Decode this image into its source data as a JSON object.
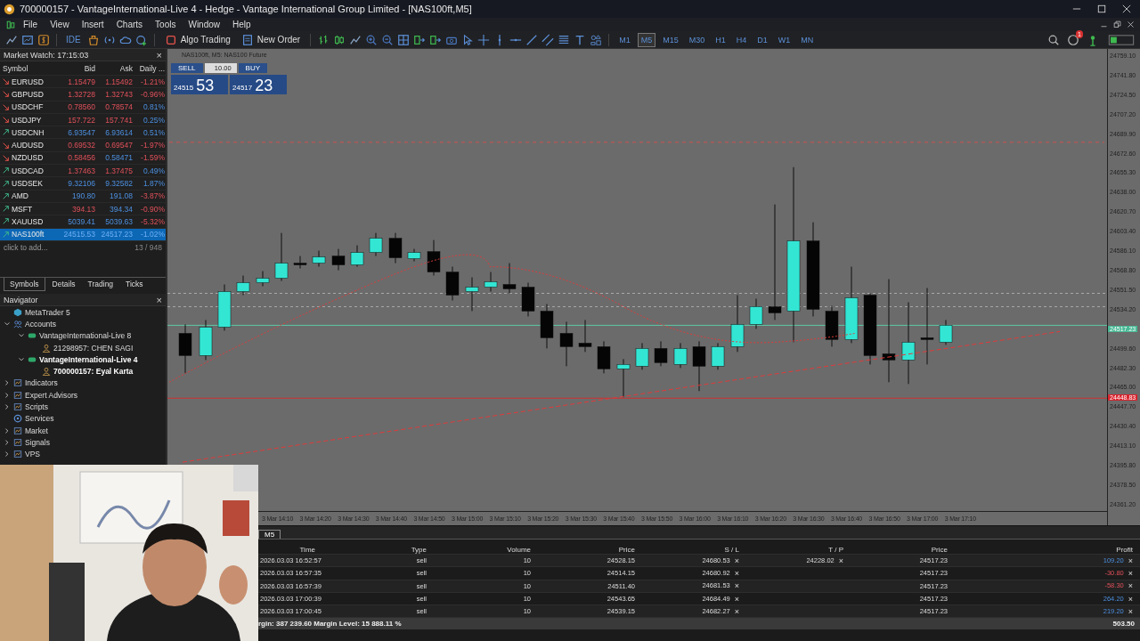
{
  "window": {
    "title": "700000157 - VantageInternational-Live 4 - Hedge - Vantage International Group Limited - [NAS100ft,M5]"
  },
  "menu": [
    "File",
    "View",
    "Insert",
    "Charts",
    "Tools",
    "Window",
    "Help"
  ],
  "toolbar": {
    "ide": "IDE",
    "algo_trading": "Algo Trading",
    "new_order": "New Order",
    "timeframes": [
      {
        "label": "M1",
        "selected": false
      },
      {
        "label": "M5",
        "selected": true
      },
      {
        "label": "M15",
        "selected": false
      },
      {
        "label": "M30",
        "selected": false
      },
      {
        "label": "H1",
        "selected": false
      },
      {
        "label": "H4",
        "selected": false
      },
      {
        "label": "D1",
        "selected": false
      },
      {
        "label": "W1",
        "selected": false
      },
      {
        "label": "MN",
        "selected": false
      }
    ],
    "notifications": "1"
  },
  "market_watch": {
    "title": "Market Watch: 17:15:03",
    "columns": [
      "Symbol",
      "Bid",
      "Ask",
      "Daily ..."
    ],
    "rows": [
      {
        "symbol": "EURUSD",
        "rising": false,
        "bid": "1.15479",
        "bid_up": false,
        "ask": "1.15492",
        "ask_up": false,
        "daily": "-1.21%",
        "daily_up": false,
        "selected": false
      },
      {
        "symbol": "GBPUSD",
        "rising": false,
        "bid": "1.32728",
        "bid_up": false,
        "ask": "1.32743",
        "ask_up": false,
        "daily": "-0.96%",
        "daily_up": false,
        "selected": false
      },
      {
        "symbol": "USDCHF",
        "rising": false,
        "bid": "0.78560",
        "bid_up": false,
        "ask": "0.78574",
        "ask_up": false,
        "daily": "0.81%",
        "daily_up": true,
        "selected": false
      },
      {
        "symbol": "USDJPY",
        "rising": false,
        "bid": "157.722",
        "bid_up": false,
        "ask": "157.741",
        "ask_up": false,
        "daily": "0.25%",
        "daily_up": true,
        "selected": false
      },
      {
        "symbol": "USDCNH",
        "rising": true,
        "bid": "6.93547",
        "bid_up": true,
        "ask": "6.93614",
        "ask_up": true,
        "daily": "0.51%",
        "daily_up": true,
        "selected": false
      },
      {
        "symbol": "AUDUSD",
        "rising": false,
        "bid": "0.69532",
        "bid_up": false,
        "ask": "0.69547",
        "ask_up": false,
        "daily": "-1.97%",
        "daily_up": false,
        "selected": false
      },
      {
        "symbol": "NZDUSD",
        "rising": false,
        "bid": "0.58456",
        "bid_up": false,
        "ask": "0.58471",
        "ask_up": true,
        "daily": "-1.59%",
        "daily_up": false,
        "selected": false
      },
      {
        "symbol": "USDCAD",
        "rising": true,
        "bid": "1.37463",
        "bid_up": false,
        "ask": "1.37475",
        "ask_up": false,
        "daily": "0.49%",
        "daily_up": true,
        "selected": false
      },
      {
        "symbol": "USDSEK",
        "rising": true,
        "bid": "9.32106",
        "bid_up": true,
        "ask": "9.32582",
        "ask_up": true,
        "daily": "1.87%",
        "daily_up": true,
        "selected": false
      },
      {
        "symbol": "AMD",
        "rising": true,
        "bid": "190.80",
        "bid_up": true,
        "ask": "191.08",
        "ask_up": true,
        "daily": "-3.87%",
        "daily_up": false,
        "selected": false
      },
      {
        "symbol": "MSFT",
        "rising": true,
        "bid": "394.13",
        "bid_up": false,
        "ask": "394.34",
        "ask_up": true,
        "daily": "-0.90%",
        "daily_up": false,
        "selected": false
      },
      {
        "symbol": "XAUUSD",
        "rising": true,
        "bid": "5039.41",
        "bid_up": true,
        "ask": "5039.63",
        "ask_up": true,
        "daily": "-5.32%",
        "daily_up": false,
        "selected": false
      },
      {
        "symbol": "NAS100ft",
        "rising": true,
        "bid": "24515.53",
        "bid_up": true,
        "ask": "24517.23",
        "ask_up": true,
        "daily": "-1.02%",
        "daily_up": false,
        "selected": true
      }
    ],
    "add": "click to add...",
    "count": "13 / 948",
    "tabs": [
      {
        "label": "Symbols",
        "selected": true
      },
      {
        "label": "Details",
        "selected": false
      },
      {
        "label": "Trading",
        "selected": false
      },
      {
        "label": "Ticks",
        "selected": false
      }
    ]
  },
  "navigator": {
    "title": "Navigator",
    "items": [
      {
        "label": "MetaTrader 5",
        "kind": "root"
      },
      {
        "label": "Accounts",
        "kind": "accounts",
        "expanded": true,
        "children": [
          {
            "label": "VantageInternational-Live 8",
            "kind": "server",
            "expanded": true,
            "active": false,
            "children": [
              {
                "label": "21298957: CHEN SAGI",
                "kind": "user",
                "active": false
              }
            ]
          },
          {
            "label": "VantageInternational-Live 4",
            "kind": "server",
            "expanded": true,
            "active": true,
            "children": [
              {
                "label": "700000157: Eyal Karta",
                "kind": "user",
                "active": true
              }
            ]
          }
        ]
      },
      {
        "label": "Indicators",
        "kind": "folder",
        "expanded": false
      },
      {
        "label": "Expert Advisors",
        "kind": "folder",
        "expanded": false
      },
      {
        "label": "Scripts",
        "kind": "folder",
        "expanded": false
      },
      {
        "label": "Services",
        "kind": "leaf"
      },
      {
        "label": "Market",
        "kind": "folder",
        "expanded": false
      },
      {
        "label": "Signals",
        "kind": "folder",
        "expanded": false
      },
      {
        "label": "VPS",
        "kind": "folder",
        "expanded": false
      }
    ]
  },
  "chart": {
    "title": "NAS100ft, M5: NAS100 Future",
    "one_click": {
      "sell": "SELL",
      "volume": "10.00",
      "buy": "BUY",
      "bid_main": "24515",
      "bid_big": "53",
      "ask_main": "24517",
      "ask_big": "23"
    },
    "price_labels": [
      "24759.10",
      "24741.80",
      "24724.50",
      "24707.20",
      "24689.90",
      "24672.60",
      "24655.30",
      "24638.00",
      "24620.70",
      "24603.40",
      "24586.10",
      "24568.80",
      "24551.50",
      "24534.20",
      "24499.60",
      "24482.30",
      "24465.00",
      "24447.70",
      "24430.40",
      "24413.10",
      "24395.80",
      "24378.50",
      "24361.20"
    ],
    "ask_tag": "24517.23",
    "bid_tag": "24448.83",
    "time_labels": [
      "3 Mar 14:10",
      "3 Mar 14:20",
      "3 Mar 14:30",
      "3 Mar 14:40",
      "3 Mar 14:50",
      "3 Mar 15:00",
      "3 Mar 15:10",
      "3 Mar 15:20",
      "3 Mar 15:30",
      "3 Mar 15:40",
      "3 Mar 15:50",
      "3 Mar 16:00",
      "3 Mar 16:10",
      "3 Mar 16:20",
      "3 Mar 16:30",
      "3 Mar 16:40",
      "3 Mar 16:50",
      "3 Mar 17:00",
      "3 Mar 17:10"
    ]
  },
  "webcam": {
    "kind": "picture"
  },
  "toolbox": {
    "tab": "M5",
    "columns": [
      "Time",
      "Type",
      "Volume",
      "Price",
      "S / L",
      "T / P",
      "Price",
      "Profit"
    ],
    "rows": [
      {
        "time": "2026.03.03 16:52:57",
        "type": "sell",
        "volume": "10",
        "price": "24528.15",
        "sl": "24680.53",
        "tp": "24228.02",
        "current": "24517.23",
        "profit": "109.20",
        "profit_up": true
      },
      {
        "time": "2026.03.03 16:57:35",
        "type": "sell",
        "volume": "10",
        "price": "24514.15",
        "sl": "24680.92",
        "current": "24517.23",
        "profit": "-30.80",
        "profit_up": false
      },
      {
        "time": "2026.03.03 16:57:39",
        "type": "sell",
        "volume": "10",
        "price": "24511.40",
        "sl": "24681.53",
        "current": "24517.23",
        "profit": "-58.30",
        "profit_up": false
      },
      {
        "time": "2026.03.03 17:00:39",
        "type": "sell",
        "volume": "10",
        "price": "24543.65",
        "sl": "24684.49",
        "current": "24517.23",
        "profit": "264.20",
        "profit_up": true
      },
      {
        "time": "2026.03.03 17:00:45",
        "type": "sell",
        "volume": "10",
        "price": "24539.15",
        "sl": "24682.27",
        "current": "24517.23",
        "profit": "219.20",
        "profit_up": true
      }
    ],
    "close_mark": "×",
    "footer": "rgin: 387 239.60  Margin Level: 15 888.11 %",
    "total": "503.50"
  }
}
